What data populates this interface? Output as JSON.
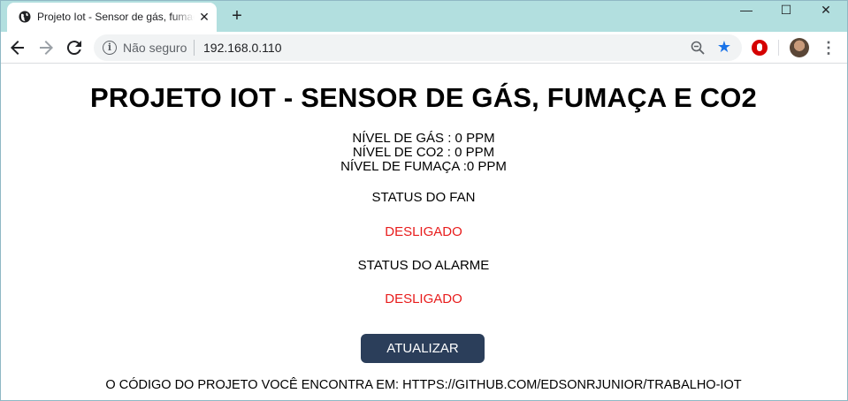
{
  "browser": {
    "tab_title": "Projeto Iot - Sensor de gás, fumaça e CO2",
    "tab_close": "✕",
    "new_tab": "+",
    "security_label": "Não seguro",
    "url": "192.168.0.110",
    "window_controls": {
      "minimize": "—",
      "maximize": "☐",
      "close": "✕"
    },
    "icons": [
      "back-arrow-icon",
      "forward-arrow-icon",
      "reload-icon",
      "info-icon",
      "zoom-icon",
      "star-icon",
      "adblock-icon",
      "avatar",
      "menu-icon"
    ]
  },
  "page": {
    "title": "PROJETO IOT - SENSOR DE GÁS, FUMAÇA E CO2",
    "readings": [
      "NÍVEL DE GÁS : 0 PPM",
      "NÍVEL DE CO2 : 0 PPM",
      "NÍVEL DE FUMAÇA :0 PPM"
    ],
    "fan": {
      "label": "STATUS DO FAN",
      "value": "DESLIGADO"
    },
    "alarm": {
      "label": "STATUS DO ALARME",
      "value": "DESLIGADO"
    },
    "update_button": "ATUALIZAR",
    "footer": "O CÓDIGO DO PROJETO VOCÊ ENCONTRA EM: HTTPS://GITHUB.COM/EDSONRJUNIOR/TRABALHO-IOT"
  },
  "colors": {
    "titlebar": "#b2dfdf",
    "status_off": "#e81c1c",
    "button_bg": "#2b3e5a"
  }
}
